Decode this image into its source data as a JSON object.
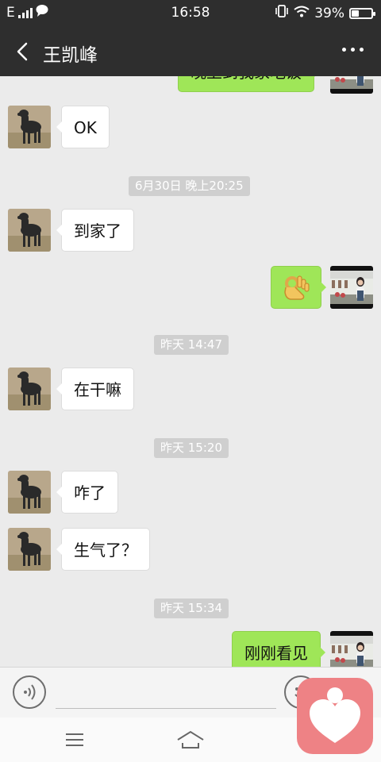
{
  "status_bar": {
    "network": "E",
    "time": "16:58",
    "battery_percent": "39%",
    "battery_level": 0.39,
    "icons": [
      "signal-icon",
      "message-notification-icon",
      "vibrate-icon",
      "wifi-icon",
      "battery-icon"
    ]
  },
  "header": {
    "title": "王凯峰",
    "back_icon": "chevron-left-icon",
    "more_icon": "more-dots-icon"
  },
  "chat": {
    "partial_top_message": "晚上到我家吃饭",
    "messages": [
      {
        "sender": "contact",
        "type": "text",
        "text": "OK"
      },
      {
        "type": "timestamp",
        "text": "6月30日 晚上20:25"
      },
      {
        "sender": "contact",
        "type": "text",
        "text": "到家了"
      },
      {
        "sender": "me",
        "type": "emoji",
        "emoji": "ok-hand-emoji"
      },
      {
        "type": "timestamp",
        "text": "昨天 14:47"
      },
      {
        "sender": "contact",
        "type": "text",
        "text": "在干嘛"
      },
      {
        "type": "timestamp",
        "text": "昨天 15:20"
      },
      {
        "sender": "contact",
        "type": "text",
        "text": "咋了"
      },
      {
        "sender": "contact",
        "type": "text",
        "text": "生气了？"
      },
      {
        "type": "timestamp",
        "text": "昨天 15:34"
      },
      {
        "sender": "me",
        "type": "text",
        "text": "刚刚看见"
      }
    ]
  },
  "input_bar": {
    "voice_icon": "voice-icon",
    "emoji_icon": "emoji-icon",
    "value": ""
  },
  "system_nav": {
    "menu_icon": "menu-icon",
    "home_icon": "home-icon"
  },
  "floating_app_icon": "heart-app-icon",
  "colors": {
    "header_bg": "#2e2e2e",
    "chat_bg": "#ebebeb",
    "outgoing_bubble": "#9fe658",
    "incoming_bubble": "#ffffff",
    "timestamp_bg": "#cfcfcf",
    "floating_app": "#ee8285"
  }
}
